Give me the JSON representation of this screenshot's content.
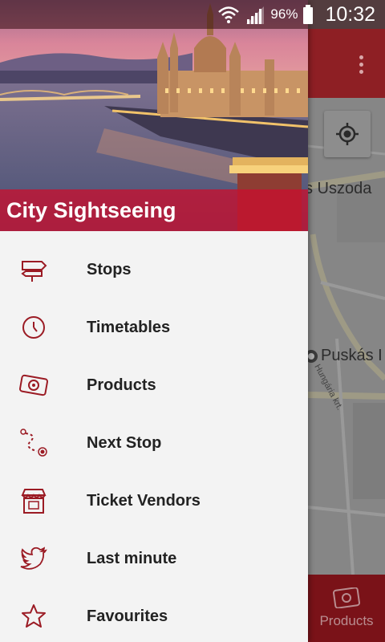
{
  "status_bar": {
    "battery": "96%",
    "time": "10:32"
  },
  "drawer": {
    "title": "City Sightseeing",
    "menu": [
      {
        "label": "Stops",
        "icon": "signpost-icon"
      },
      {
        "label": "Timetables",
        "icon": "clock-icon"
      },
      {
        "label": "Products",
        "icon": "ticket-icon"
      },
      {
        "label": "Next Stop",
        "icon": "route-icon"
      },
      {
        "label": "Ticket Vendors",
        "icon": "storefront-icon"
      },
      {
        "label": "Last minute",
        "icon": "twitter-bird-icon"
      },
      {
        "label": "Favourites",
        "icon": "star-icon"
      }
    ]
  },
  "map": {
    "label_uszoda": "s Uszoda",
    "label_puskas": "Puskás I",
    "label_street": "Hungária krt."
  },
  "bottom_tab": {
    "label": "Products"
  },
  "colors": {
    "brand_red": "#c8102e",
    "icon_red": "#9b1b24",
    "drawer_bg": "#f3f3f3"
  }
}
